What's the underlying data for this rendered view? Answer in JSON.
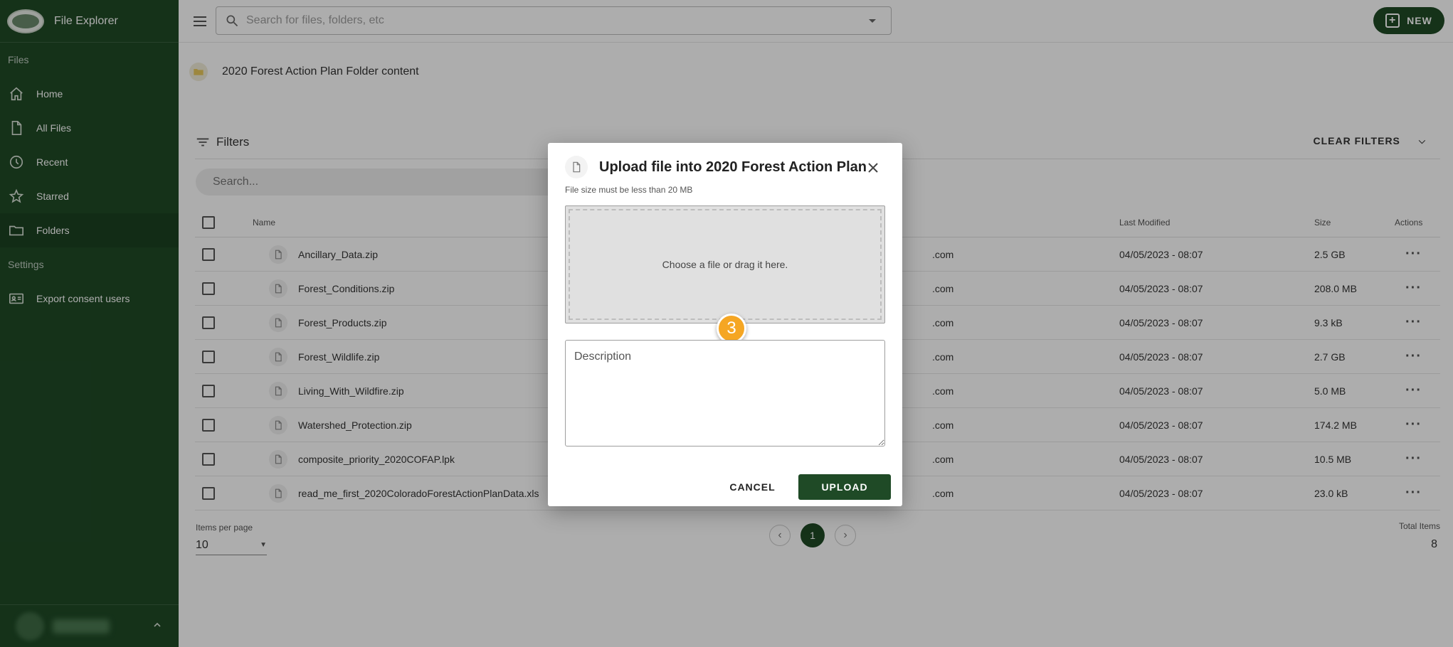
{
  "app": {
    "title": "File Explorer"
  },
  "sidebar": {
    "section_files": "Files",
    "section_settings": "Settings",
    "items": [
      {
        "label": "Home",
        "icon": "home-icon"
      },
      {
        "label": "All Files",
        "icon": "file-icon"
      },
      {
        "label": "Recent",
        "icon": "clock-icon"
      },
      {
        "label": "Starred",
        "icon": "star-icon"
      },
      {
        "label": "Folders",
        "icon": "folder-icon",
        "active": true
      }
    ],
    "settings_items": [
      {
        "label": "Export consent users",
        "icon": "id-card-icon"
      }
    ]
  },
  "topbar": {
    "search_placeholder": "Search for files, folders, etc",
    "new_label": "NEW"
  },
  "folder": {
    "title": "2020 Forest Action Plan Folder content"
  },
  "filters": {
    "label": "Filters",
    "clear_label": "CLEAR FILTERS"
  },
  "file_search": {
    "placeholder": "Search..."
  },
  "table": {
    "columns": {
      "name": "Name",
      "last_modified": "Last Modified",
      "size": "Size",
      "actions": "Actions"
    },
    "rows": [
      {
        "name": "Ancillary_Data.zip",
        "owner_suffix": ".com",
        "modified": "04/05/2023 - 08:07",
        "size": "2.5 GB"
      },
      {
        "name": "Forest_Conditions.zip",
        "owner_suffix": ".com",
        "modified": "04/05/2023 - 08:07",
        "size": "208.0 MB"
      },
      {
        "name": "Forest_Products.zip",
        "owner_suffix": ".com",
        "modified": "04/05/2023 - 08:07",
        "size": "9.3 kB"
      },
      {
        "name": "Forest_Wildlife.zip",
        "owner_suffix": ".com",
        "modified": "04/05/2023 - 08:07",
        "size": "2.7 GB"
      },
      {
        "name": "Living_With_Wildfire.zip",
        "owner_suffix": ".com",
        "modified": "04/05/2023 - 08:07",
        "size": "5.0 MB"
      },
      {
        "name": "Watershed_Protection.zip",
        "owner_suffix": ".com",
        "modified": "04/05/2023 - 08:07",
        "size": "174.2 MB"
      },
      {
        "name": "composite_priority_2020COFAP.lpk",
        "owner_suffix": ".com",
        "modified": "04/05/2023 - 08:07",
        "size": "10.5 MB"
      },
      {
        "name": "read_me_first_2020ColoradoForestActionPlanData.xls",
        "owner_suffix": ".com",
        "modified": "04/05/2023 - 08:07",
        "size": "23.0 kB"
      }
    ]
  },
  "pagination": {
    "items_per_page_label": "Items per page",
    "items_per_page": "10",
    "current_page": "1",
    "total_label": "Total Items",
    "total": "8"
  },
  "dialog": {
    "title": "Upload file into 2020 Forest Action Plan",
    "subtitle": "File size must be less than 20 MB",
    "dropzone_text": "Choose a file or drag it here.",
    "description_placeholder": "Description",
    "cancel_label": "CANCEL",
    "upload_label": "UPLOAD",
    "step_badge": "3"
  },
  "colors": {
    "brand": "#1f4a26",
    "badge": "#f5a623"
  }
}
